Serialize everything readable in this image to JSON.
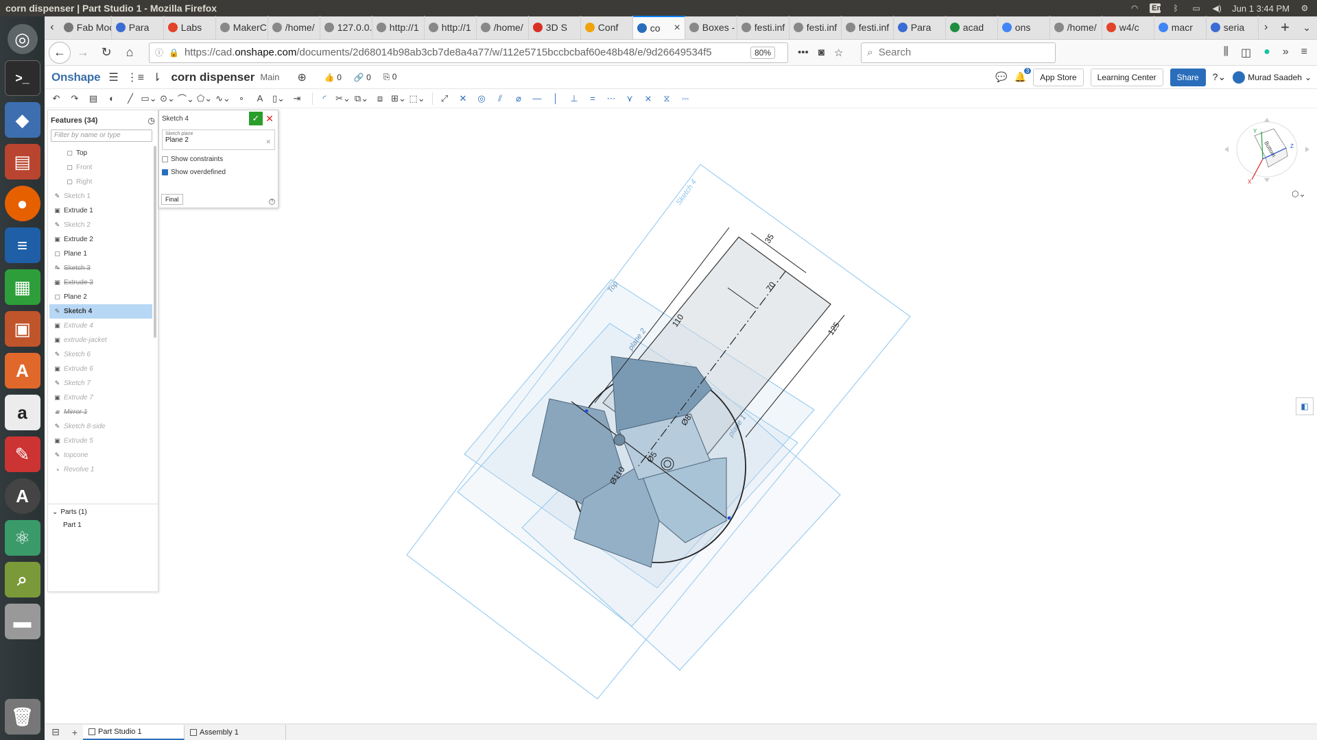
{
  "window": {
    "title": "corn dispenser | Part Studio 1 - Mozilla Firefox"
  },
  "system_tray": {
    "keyboard": "En",
    "datetime": "Jun 1  3:44 PM"
  },
  "browser": {
    "tabs": [
      {
        "label": "Fab Moc",
        "color": "#777777"
      },
      {
        "label": "Para",
        "color": "#3b6cd4"
      },
      {
        "label": "Labs",
        "color": "#e24329"
      },
      {
        "label": "MakerC",
        "color": "#888888"
      },
      {
        "label": "/home/",
        "color": "#888888"
      },
      {
        "label": "127.0.0.",
        "color": "#888888"
      },
      {
        "label": "http://1",
        "color": "#888888"
      },
      {
        "label": "http://1",
        "color": "#888888"
      },
      {
        "label": "/home/",
        "color": "#888888"
      },
      {
        "label": "3D S",
        "color": "#d93025"
      },
      {
        "label": "Conf",
        "color": "#f0a30a"
      },
      {
        "label": "co",
        "color": "#2a6ebb",
        "active": true
      },
      {
        "label": "Boxes -",
        "color": "#888888"
      },
      {
        "label": "festi.inf",
        "color": "#888888"
      },
      {
        "label": "festi.inf",
        "color": "#888888"
      },
      {
        "label": "festi.inf",
        "color": "#888888"
      },
      {
        "label": "Para",
        "color": "#3b6cd4"
      },
      {
        "label": "acad",
        "color": "#1e8e3e"
      },
      {
        "label": "ons",
        "color": "#4285f4"
      },
      {
        "label": "/home/",
        "color": "#888888"
      },
      {
        "label": "w4/c",
        "color": "#e24329"
      },
      {
        "label": "macr",
        "color": "#4285f4"
      },
      {
        "label": "seria",
        "color": "#3b6cd4"
      }
    ],
    "url_prefix": "https://cad.",
    "url_domain": "onshape.com",
    "url_rest": "/documents/2d68014b98ab3cb7de8a4a77/w/112e5715bccbcbaf60e48b48/e/9d26649534f5",
    "zoom": "80%",
    "search_placeholder": "Search"
  },
  "onshape": {
    "logo": "Onshape",
    "document_name": "corn dispenser",
    "branch": "Main",
    "likes": "0",
    "links": "0",
    "copies": "0",
    "notif_count": "3",
    "app_store": "App Store",
    "learning_center": "Learning Center",
    "share": "Share",
    "user": "Murad Saadeh"
  },
  "features": {
    "header": "Features (34)",
    "filter_placeholder": "Filter by name or type",
    "items": [
      {
        "label": "Top",
        "kind": "plane",
        "state": "normal"
      },
      {
        "label": "Front",
        "kind": "plane",
        "state": "dimplane"
      },
      {
        "label": "Right",
        "kind": "plane",
        "state": "dimplane"
      },
      {
        "label": "Sketch 1",
        "kind": "sketch",
        "state": "dimplane"
      },
      {
        "label": "Extrude 1",
        "kind": "extrude",
        "state": "normal"
      },
      {
        "label": "Sketch 2",
        "kind": "sketch",
        "state": "dimplane"
      },
      {
        "label": "Extrude 2",
        "kind": "extrude",
        "state": "normal"
      },
      {
        "label": "Plane 1",
        "kind": "planefeat",
        "state": "normal"
      },
      {
        "label": "Sketch 3",
        "kind": "sketch",
        "state": "strike"
      },
      {
        "label": "Extrude 3",
        "kind": "extrude",
        "state": "strike"
      },
      {
        "label": "Plane 2",
        "kind": "planefeat",
        "state": "normal"
      },
      {
        "label": "Sketch 4",
        "kind": "sketch",
        "state": "selected"
      },
      {
        "label": "Extrude 4",
        "kind": "extrude",
        "state": "dim"
      },
      {
        "label": "extrude-jacket",
        "kind": "extrude",
        "state": "dim"
      },
      {
        "label": "Sketch 6",
        "kind": "sketch",
        "state": "dim"
      },
      {
        "label": "Extrude 6",
        "kind": "extrude",
        "state": "dim"
      },
      {
        "label": "Sketch 7",
        "kind": "sketch",
        "state": "dim"
      },
      {
        "label": "Extrude 7",
        "kind": "extrude",
        "state": "dim"
      },
      {
        "label": "Mirror 1",
        "kind": "mirror",
        "state": "dimstrike"
      },
      {
        "label": "Sketch 8-side",
        "kind": "sketch",
        "state": "dim"
      },
      {
        "label": "Extrude 5",
        "kind": "extrude",
        "state": "dim"
      },
      {
        "label": "topcone",
        "kind": "sketch",
        "state": "dim"
      },
      {
        "label": "Revolve 1",
        "kind": "revolve",
        "state": "dim"
      }
    ],
    "parts_header": "Parts (1)",
    "parts": [
      "Part 1"
    ]
  },
  "sketch_dialog": {
    "title": "Sketch 4",
    "plane_label": "Sketch plane",
    "plane_value": "Plane 2",
    "show_constraints": "Show constraints",
    "show_overdefined": "Show overdefined",
    "final": "Final"
  },
  "viewport": {
    "plane_labels": [
      "Sketch 4",
      "Top",
      "plane 2",
      "plane 1"
    ],
    "dimensions": [
      "35",
      "70",
      "110",
      "125",
      "Ø110",
      "Ø8",
      "Ø5"
    ],
    "cube_face": "Bottom",
    "cube_axes": [
      "Y",
      "Z",
      "X"
    ]
  },
  "bottom_tabs": [
    "Part Studio 1",
    "Assembly 1"
  ],
  "launcher_icons": [
    "ubuntu-icon",
    "terminal-icon",
    "cube-app-icon",
    "files-icon",
    "firefox-icon",
    "writer-icon",
    "calc-icon",
    "impress-icon",
    "software-center-icon",
    "amazon-icon",
    "settings-icon",
    "updater-icon",
    "atom-icon",
    "image-viewer-icon",
    "drive-icon",
    "trash-icon"
  ]
}
